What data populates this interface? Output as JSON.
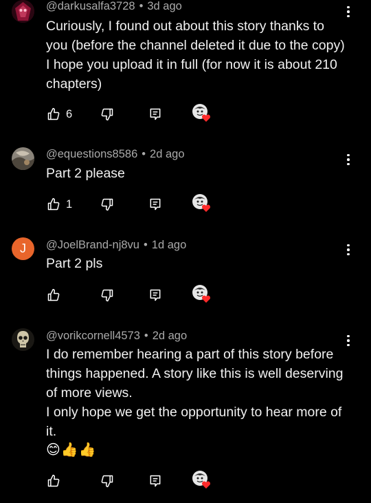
{
  "comments": [
    {
      "author": "@darkusalfa3728",
      "time": "3d ago",
      "separator": "•",
      "text": "Curiously, I found out about this story thanks to you (before the channel deleted it due to the copy) I hope you upload it in full (for now it is about 210 chapters)",
      "likes": "6",
      "avatar_color": "#7a1030"
    },
    {
      "author": "@equestions8586",
      "time": "2d ago",
      "separator": "•",
      "text": "Part 2 please",
      "likes": "1",
      "avatar_color": "#6f6a60"
    },
    {
      "author": "@JoelBrand-nj8vu",
      "time": "1d ago",
      "separator": "•",
      "text": "Part 2 pls",
      "likes": "",
      "avatar_letter": "J",
      "avatar_color": "#e8652b"
    },
    {
      "author": "@vorikcornell4573",
      "time": "2d ago",
      "separator": "•",
      "text_lines": [
        "I do remember hearing a part of this story before things happened. A story like this is well deserving of more views.",
        "I only hope we get the opportunity to hear more of it."
      ],
      "emojis": "😊👍👍",
      "likes": "",
      "avatar_color": "#3a3630"
    }
  ],
  "icons": {
    "like": "thumbs-up-icon",
    "dislike": "thumbs-down-icon",
    "reply": "reply-icon",
    "creator_heart": "creator-heart-icon",
    "menu": "more-vertical-icon"
  },
  "colors": {
    "background": "#000000",
    "heart": "#ff2a2a",
    "meta": "#aaaaaa"
  }
}
